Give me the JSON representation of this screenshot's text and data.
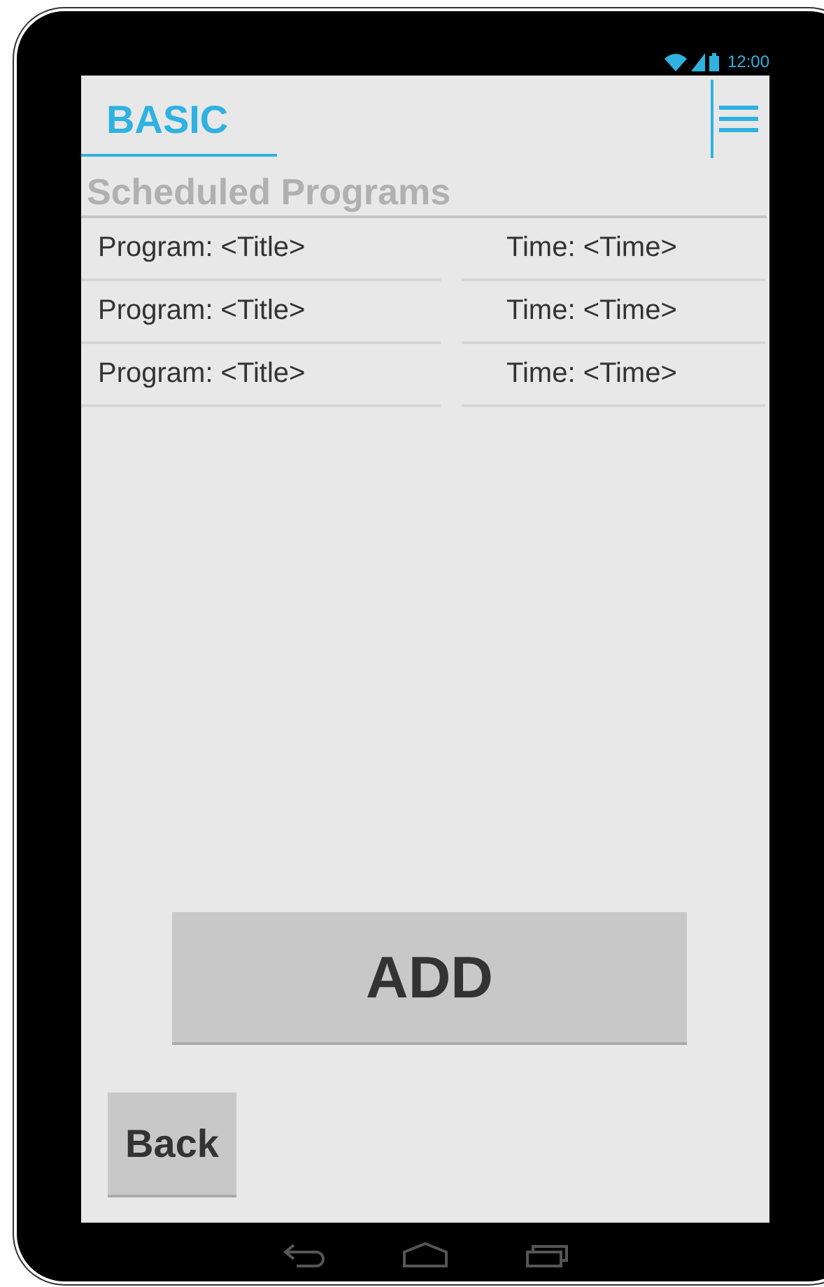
{
  "status_bar": {
    "time": "12:00"
  },
  "header": {
    "tab": {
      "label": "BASIC",
      "selected": true
    }
  },
  "section_title": "Scheduled Programs",
  "programs": [
    {
      "program": "Program: <Title>",
      "time": "Time: <Time>"
    },
    {
      "program": "Program: <Title>",
      "time": "Time: <Time>"
    },
    {
      "program": "Program: <Title>",
      "time": "Time: <Time>"
    }
  ],
  "buttons": {
    "add": "ADD",
    "back": "Back"
  }
}
